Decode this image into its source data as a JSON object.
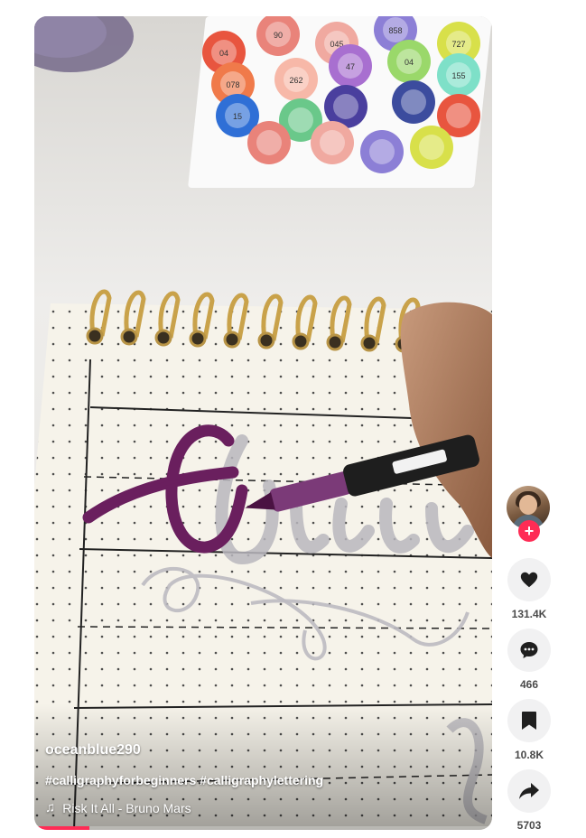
{
  "video": {
    "username": "oceanblue290",
    "caption": "#calligraphyforbeginners #calligraphylettering",
    "music": "Risk It All - Bruno Mars",
    "progress": 0.12
  },
  "marker_labels": [
    "04",
    "90",
    "045",
    "858",
    "727",
    "078",
    "262",
    "47",
    "04",
    "155",
    "15"
  ],
  "actions": {
    "likes": "131.4K",
    "comments": "466",
    "saves": "10.8K",
    "shares": "5703"
  },
  "icons": {
    "like": "heart-icon",
    "comment": "comment-icon",
    "save": "bookmark-icon",
    "share": "share-icon",
    "music": "music-note-icon",
    "follow": "plus-icon"
  },
  "colors": {
    "accent": "#fe2c55",
    "action_bg": "#f1f1f2"
  }
}
